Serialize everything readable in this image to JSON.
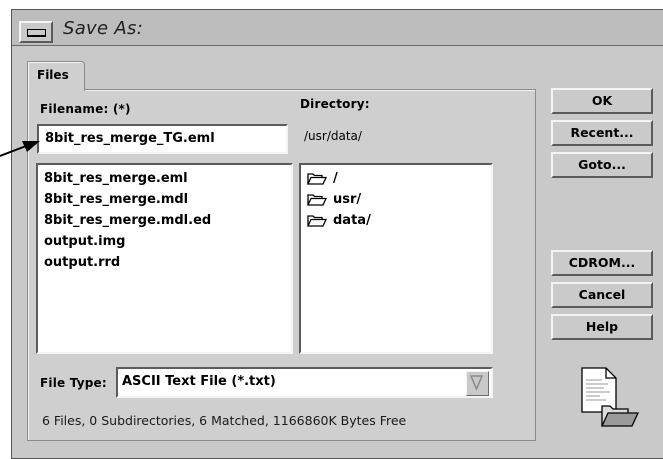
{
  "window": {
    "title": "Save As:"
  },
  "tabs": [
    {
      "label": "Files"
    }
  ],
  "labels": {
    "filename": "Filename: (*)",
    "directory": "Directory:",
    "file_type": "File Type:"
  },
  "filename_value": "8bit_res_merge_TG.eml",
  "directory_path": "/usr/data/",
  "files": [
    "8bit_res_merge.eml",
    "8bit_res_merge.mdl",
    "8bit_res_merge.mdl.ed",
    "output.img",
    "output.rrd"
  ],
  "directories": [
    "/",
    "usr/",
    "data/"
  ],
  "file_type_value": "ASCII Text File (*.txt)",
  "status": "6 Files, 0 Subdirectories, 6 Matched, 1166860K Bytes Free",
  "buttons": {
    "ok": "OK",
    "recent": "Recent...",
    "goto": "Goto...",
    "cdrom": "CDROM...",
    "cancel": "Cancel",
    "help": "Help"
  },
  "icons": {
    "system_menu": "window-menu-icon",
    "folder": "folder-icon",
    "dropdown": "dropdown-arrow-icon",
    "document": "document-folder-icon",
    "pointer": "arrow-pointer-icon"
  }
}
